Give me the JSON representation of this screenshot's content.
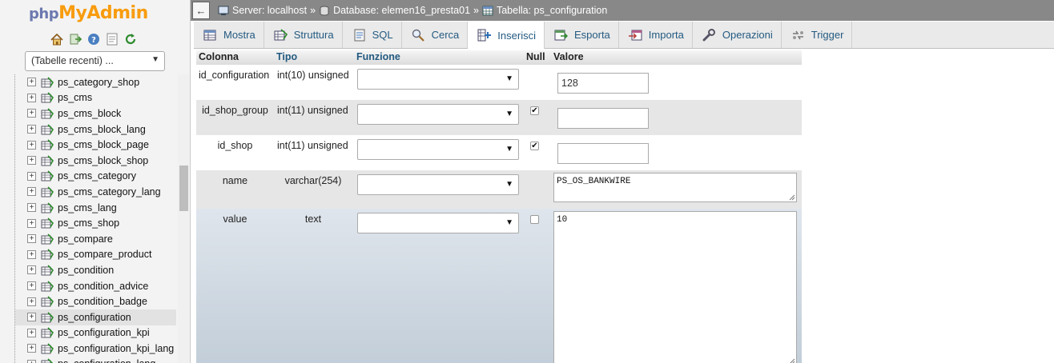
{
  "nav": {
    "logo_php": "php",
    "logo_myadmin": "MyAdmin",
    "icons": [
      "home-icon",
      "exit-icon",
      "help-icon",
      "docs-icon",
      "reload-icon"
    ],
    "recent_label": "(Tabelle recenti) ...",
    "tables": [
      "ps_category_shop",
      "ps_cms",
      "ps_cms_block",
      "ps_cms_block_lang",
      "ps_cms_block_page",
      "ps_cms_block_shop",
      "ps_cms_category",
      "ps_cms_category_lang",
      "ps_cms_lang",
      "ps_cms_shop",
      "ps_compare",
      "ps_compare_product",
      "ps_condition",
      "ps_condition_advice",
      "ps_condition_badge",
      "ps_configuration",
      "ps_configuration_kpi",
      "ps_configuration_kpi_lang",
      "ps_configuration_lang"
    ],
    "selected_table": "ps_configuration"
  },
  "breadcrumb": {
    "back": "←",
    "server": "Server: localhost",
    "database": "Database: elemen16_presta01",
    "table": "Tabella: ps_configuration",
    "sep": "»"
  },
  "tabs": [
    {
      "label": "Mostra",
      "icon": "browse-icon"
    },
    {
      "label": "Struttura",
      "icon": "structure-icon"
    },
    {
      "label": "SQL",
      "icon": "sql-icon"
    },
    {
      "label": "Cerca",
      "icon": "search-icon"
    },
    {
      "label": "Inserisci",
      "icon": "insert-icon",
      "active": true
    },
    {
      "label": "Esporta",
      "icon": "export-icon"
    },
    {
      "label": "Importa",
      "icon": "import-icon"
    },
    {
      "label": "Operazioni",
      "icon": "wrench-icon"
    },
    {
      "label": "Trigger",
      "icon": "trigger-icon"
    }
  ],
  "headers": {
    "column": "Colonna",
    "type": "Tipo",
    "function": "Funzione",
    "null": "Null",
    "value": "Valore"
  },
  "fields": [
    {
      "name": "id_configuration",
      "type": "int(10) unsigned",
      "null_checked": null,
      "value": "128"
    },
    {
      "name": "id_shop_group",
      "type": "int(11) unsigned",
      "null_checked": true,
      "value": ""
    },
    {
      "name": "id_shop",
      "type": "int(11) unsigned",
      "null_checked": true,
      "value": ""
    },
    {
      "name": "name",
      "type": "varchar(254)",
      "null_checked": null,
      "value": "PS_OS_BANKWIRE"
    },
    {
      "name": "value",
      "type": "text",
      "null_checked": false,
      "value": "10"
    }
  ],
  "checkmark": "✔",
  "dropdown_arrow": "▼"
}
